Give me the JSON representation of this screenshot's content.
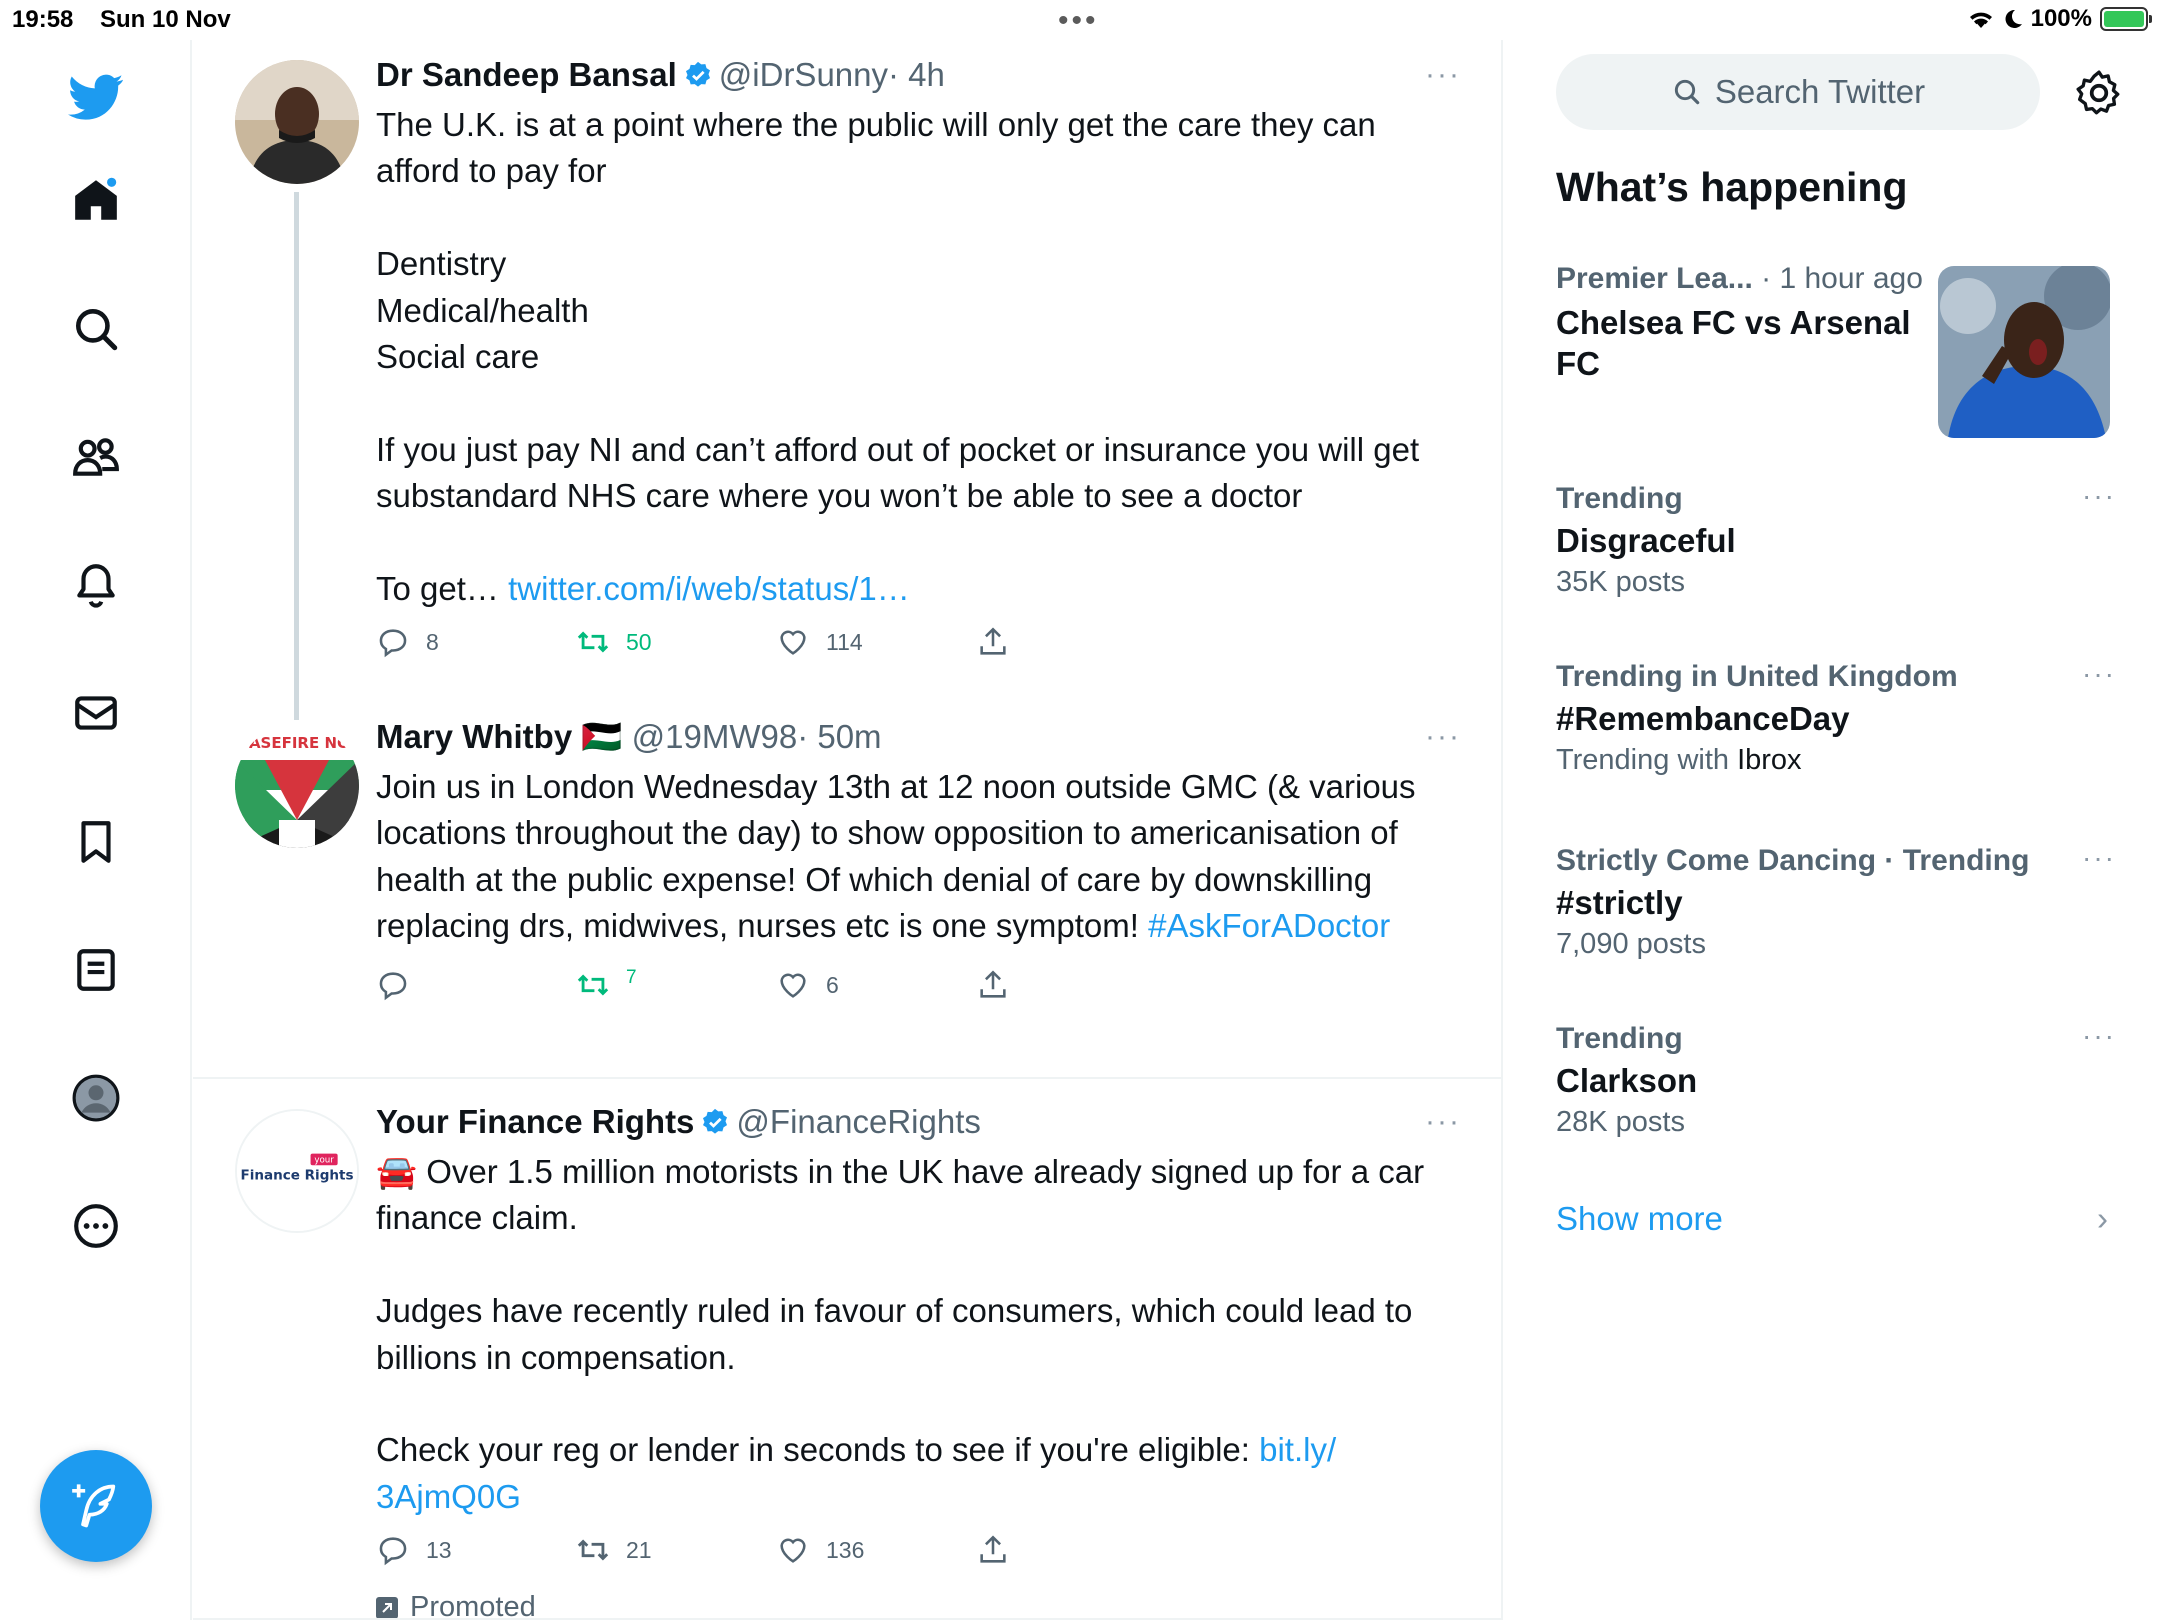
{
  "status_bar": {
    "time": "19:58",
    "date": "Sun 10 Nov",
    "battery": "100%",
    "multitask_dots": "•••"
  },
  "sidebar": {
    "items": [
      {
        "icon": "twitter-bird-logo"
      },
      {
        "icon": "home-icon",
        "has_badge": true
      },
      {
        "icon": "search-icon"
      },
      {
        "icon": "communities-icon"
      },
      {
        "icon": "notifications-bell-icon"
      },
      {
        "icon": "messages-mail-icon"
      },
      {
        "icon": "bookmark-icon"
      },
      {
        "icon": "lists-icon"
      },
      {
        "icon": "profile-avatar-icon"
      },
      {
        "icon": "more-circle-icon"
      }
    ],
    "compose_icon": "compose-feather-plus-icon"
  },
  "timeline": {
    "tweets": [
      {
        "name": "Dr Sandeep Bansal",
        "verified": true,
        "handle": "@iDrSunny",
        "time": "· 4h",
        "more": "···",
        "text": "The U.K. is at a point where the public will only get the care they can afford to pay for\n\nDentistry\nMedical/health\nSocial care\n\nIf you just pay NI and can’t afford out of pocket or insurance you will get substandard NHS care where you won’t be able to see a doctor\n\nTo get… ",
        "link": "twitter.com/i/web/status/1…",
        "replies": "8",
        "retweets": "50",
        "likes": "114",
        "retweeted": true
      },
      {
        "name": "Mary Whitby",
        "flag": "🇵🇸",
        "handle": "@19MW98",
        "time": "· 50m",
        "more": "···",
        "text": "Join us in London Wednesday 13th at 12 noon outside GMC (& various locations throughout the day) to show opposition to americanisation of health at the public expense! Of which denial of care by downskilling replacing drs, midwives, nurses etc is one symptom! ",
        "link": "#AskForADoctor",
        "avatar_text": "CEASEFIRE NOW",
        "replies": "",
        "retweets": "7",
        "likes": "6",
        "retweeted": true
      },
      {
        "name": "Your Finance Rights",
        "verified": true,
        "handle": "@FinanceRights",
        "more": "···",
        "emoji": "🚘",
        "text1": " Over 1.5 million motorists in the UK have already signed up for a car finance claim.\n\nJudges have recently ruled in favour of consumers, which could lead to billions in compensation.\n\nCheck your reg or lender in seconds to see if you're eligible: ",
        "link": "bit.ly/\n3AjmQ0G",
        "avatar_top": "your",
        "avatar_main": "Finance Rights",
        "replies": "13",
        "retweets": "21",
        "likes": "136",
        "retweeted": false,
        "promoted": "Promoted"
      }
    ]
  },
  "right": {
    "search_placeholder": "Search Twitter",
    "whats_happening": "What’s happening",
    "news": {
      "source": "Premier Lea...",
      "time": "· 1 hour ago",
      "title": "Chelsea FC vs Arsenal FC"
    },
    "trends": [
      {
        "context": "Trending",
        "title": "Disgraceful",
        "sub": "35K posts"
      },
      {
        "context": "Trending in United Kingdom",
        "title": "#RemembanceDay",
        "sub_prefix": "Trending with ",
        "sub_strong": "Ibrox"
      },
      {
        "context": "Strictly Come Dancing · Trending",
        "title": "#strictly",
        "sub": "7,090 posts"
      },
      {
        "context": "Trending",
        "title": "Clarkson",
        "sub": "28K posts"
      }
    ],
    "trend_more": "···",
    "show_more": "Show more",
    "show_more_chevron": "›"
  },
  "colors": {
    "accent": "#1d9bf0",
    "retweet_green": "#00ba7c",
    "secondary_text": "#536471"
  }
}
